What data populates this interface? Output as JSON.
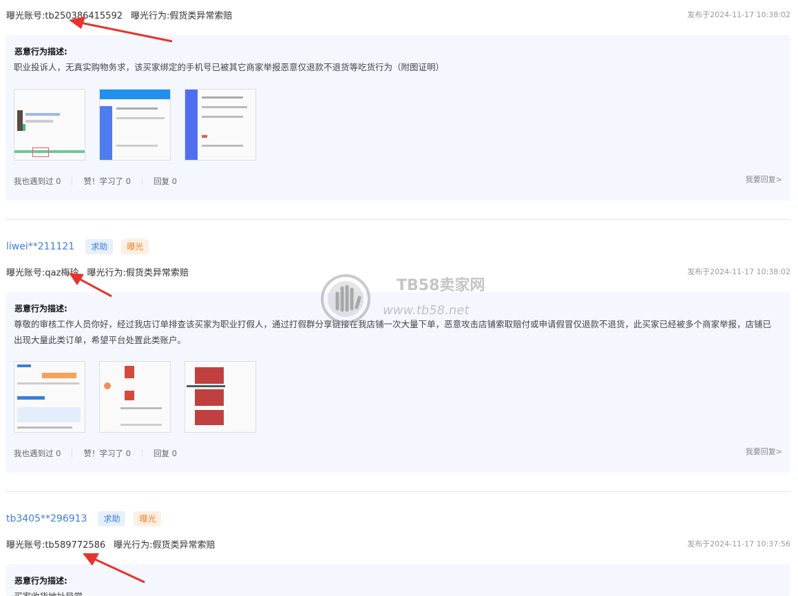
{
  "posts": [
    {
      "account_label": "曝光账号:tb250386415592",
      "behavior_label": "曝光行为:假货类异常索赔",
      "date": "发布于2024-11-17 10:38:02",
      "desc_title": "恶意行为描述:",
      "desc": "职业投诉人，无真实购物务求，该买家绑定的手机号已被其它商家举报恶意仅退款不退货等吃货行为（附图证明）",
      "actions": {
        "met": "我也遇到过 0",
        "like": "赞！学习了 0",
        "reply": "回复 0",
        "reply_link": "我要回复>"
      }
    },
    {
      "author": "liwei**211121",
      "tag_help": "求助",
      "tag_expose": "曝光",
      "account_label": "曝光账号:qaz梅玲",
      "behavior_label": "曝光行为:假货类异常索赔",
      "date": "发布于2024-11-17 10:38:02",
      "desc_title": "恶意行为描述:",
      "desc": "尊敬的审核工作人员你好，经过我店订单排查该买家为职业打假人，通过打假群分享链接在我店铺一次大量下单，恶意攻击店铺索取赔付或申请假冒仅退款不退货，此买家已经被多个商家举报，店铺已出现大量此类订单，希望平台处置此类账户。",
      "actions": {
        "met": "我也遇到过 0",
        "like": "赞！学习了 0",
        "reply": "回复 0",
        "reply_link": "我要回复>"
      }
    },
    {
      "author": "tb3405**296913",
      "tag_help": "求助",
      "tag_expose": "曝光",
      "account_label": "曝光账号:tb589772586",
      "behavior_label": "曝光行为:假货类异常索赔",
      "date": "发布于2024-11-17 10:37:56",
      "desc_title": "恶意行为描述:",
      "desc": "买家收货地址异常"
    }
  ],
  "watermark": {
    "title": "TB58卖家网",
    "url": "www.tb58.net"
  },
  "colors": {
    "link": "#3a7fd5",
    "arrow": "#e8322b",
    "card_bg": "#f4f7fe"
  }
}
